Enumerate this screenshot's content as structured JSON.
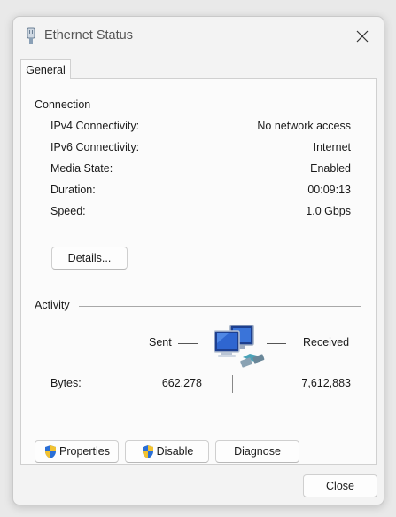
{
  "window": {
    "title": "Ethernet Status",
    "tab": "General"
  },
  "connection": {
    "heading": "Connection",
    "rows": [
      {
        "label": "IPv4 Connectivity:",
        "value": "No network access"
      },
      {
        "label": "IPv6 Connectivity:",
        "value": "Internet"
      },
      {
        "label": "Media State:",
        "value": "Enabled"
      },
      {
        "label": "Duration:",
        "value": "00:09:13"
      },
      {
        "label": "Speed:",
        "value": "1.0 Gbps"
      }
    ],
    "details_button": "Details..."
  },
  "activity": {
    "heading": "Activity",
    "sent_label": "Sent",
    "received_label": "Received",
    "bytes_label": "Bytes:",
    "bytes_sent": "662,278",
    "bytes_received": "7,612,883"
  },
  "actions": {
    "properties": "Properties",
    "disable": "Disable",
    "diagnose": "Diagnose"
  },
  "footer": {
    "close": "Close"
  },
  "icons": {
    "title": "ethernet-cable-icon",
    "network": "network-computers-icon",
    "shield": "uac-shield-icon"
  }
}
